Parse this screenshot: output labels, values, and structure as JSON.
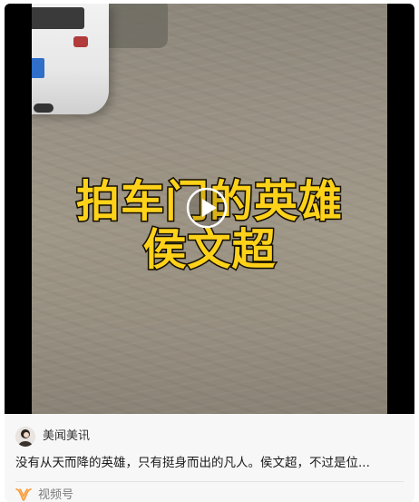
{
  "video": {
    "caption_line1": "拍车门的英雄",
    "caption_line2": "侯文超",
    "play_icon": "play-icon"
  },
  "author": {
    "name": "美闻美讯",
    "avatar_icon": "avatar"
  },
  "description": "没有从天而降的英雄，只有挺身而出的凡人。侯文超，不过是位...",
  "source": {
    "label": "视频号",
    "icon": "channels-icon",
    "accent": "#fa9d3b"
  },
  "colors": {
    "caption": "#ffd21a",
    "background": "#f7f7f7"
  }
}
